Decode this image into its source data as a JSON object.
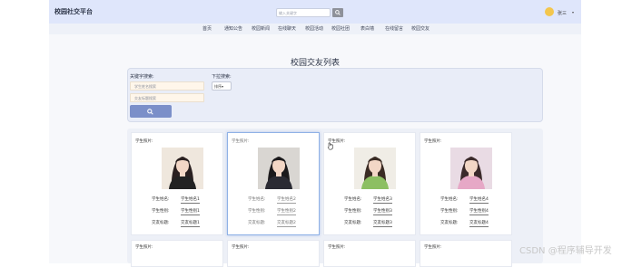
{
  "header": {
    "brand": "校园社交平台",
    "search_placeholder": "输入关键字",
    "user_name": "张三",
    "caret": "▾"
  },
  "nav": {
    "items": [
      "首页",
      "通知公告",
      "校园新闻",
      "在线聊天",
      "校园活动",
      "校园社团",
      "表白墙",
      "在线留言",
      "校园交友"
    ]
  },
  "page": {
    "title": "校园交友列表"
  },
  "filter": {
    "keyword_label": "关键字搜索:",
    "name_placeholder": "学生姓名搜索",
    "title_placeholder": "交友标题搜索",
    "dropdown_label": "下拉搜索:",
    "dropdown_value": "排序▾"
  },
  "cards": [
    {
      "photo_label": "学生照片:",
      "name_label": "学生姓名:",
      "name": "学生姓名1",
      "id_label": "学生性别:",
      "gender": "学生性别1",
      "title_label": "交友标题:",
      "friend_title": "交友标题1",
      "hair": "#2a2020",
      "bg": "#efe7dd",
      "shirt": "#222222"
    },
    {
      "photo_label": "学生照片:",
      "name_label": "学生姓名:",
      "name": "学生姓名2",
      "id_label": "学生性别:",
      "gender": "学生性别2",
      "title_label": "交友标题:",
      "friend_title": "交友标题2",
      "hair": "#1c1a1c",
      "bg": "#d9d6d2",
      "shirt": "#2b2b33"
    },
    {
      "photo_label": "学生照片:",
      "name_label": "学生姓名:",
      "name": "学生姓名3",
      "id_label": "学生性别:",
      "gender": "学生性别3",
      "title_label": "交友标题:",
      "friend_title": "交友标题3",
      "hair": "#3a2b24",
      "bg": "#f0ede6",
      "shirt": "#8cbf62"
    },
    {
      "photo_label": "学生照片:",
      "name_label": "学生姓名:",
      "name": "学生姓名4",
      "id_label": "学生性别:",
      "gender": "学生性别4",
      "title_label": "交友标题:",
      "friend_title": "交友标题4",
      "hair": "#3b2a2a",
      "bg": "#e9dbe4",
      "shirt": "#e6a8c6"
    }
  ],
  "cards_row2": [
    {
      "photo_label": "学生照片:"
    },
    {
      "photo_label": "学生照片:"
    },
    {
      "photo_label": "学生照片:"
    },
    {
      "photo_label": "学生照片:"
    }
  ],
  "watermark": "CSDN @程序辅导开发",
  "colors": {
    "topbar": "#dfe6fb",
    "search_button": "#7b8fc9",
    "avatar": "#f3c64d"
  }
}
